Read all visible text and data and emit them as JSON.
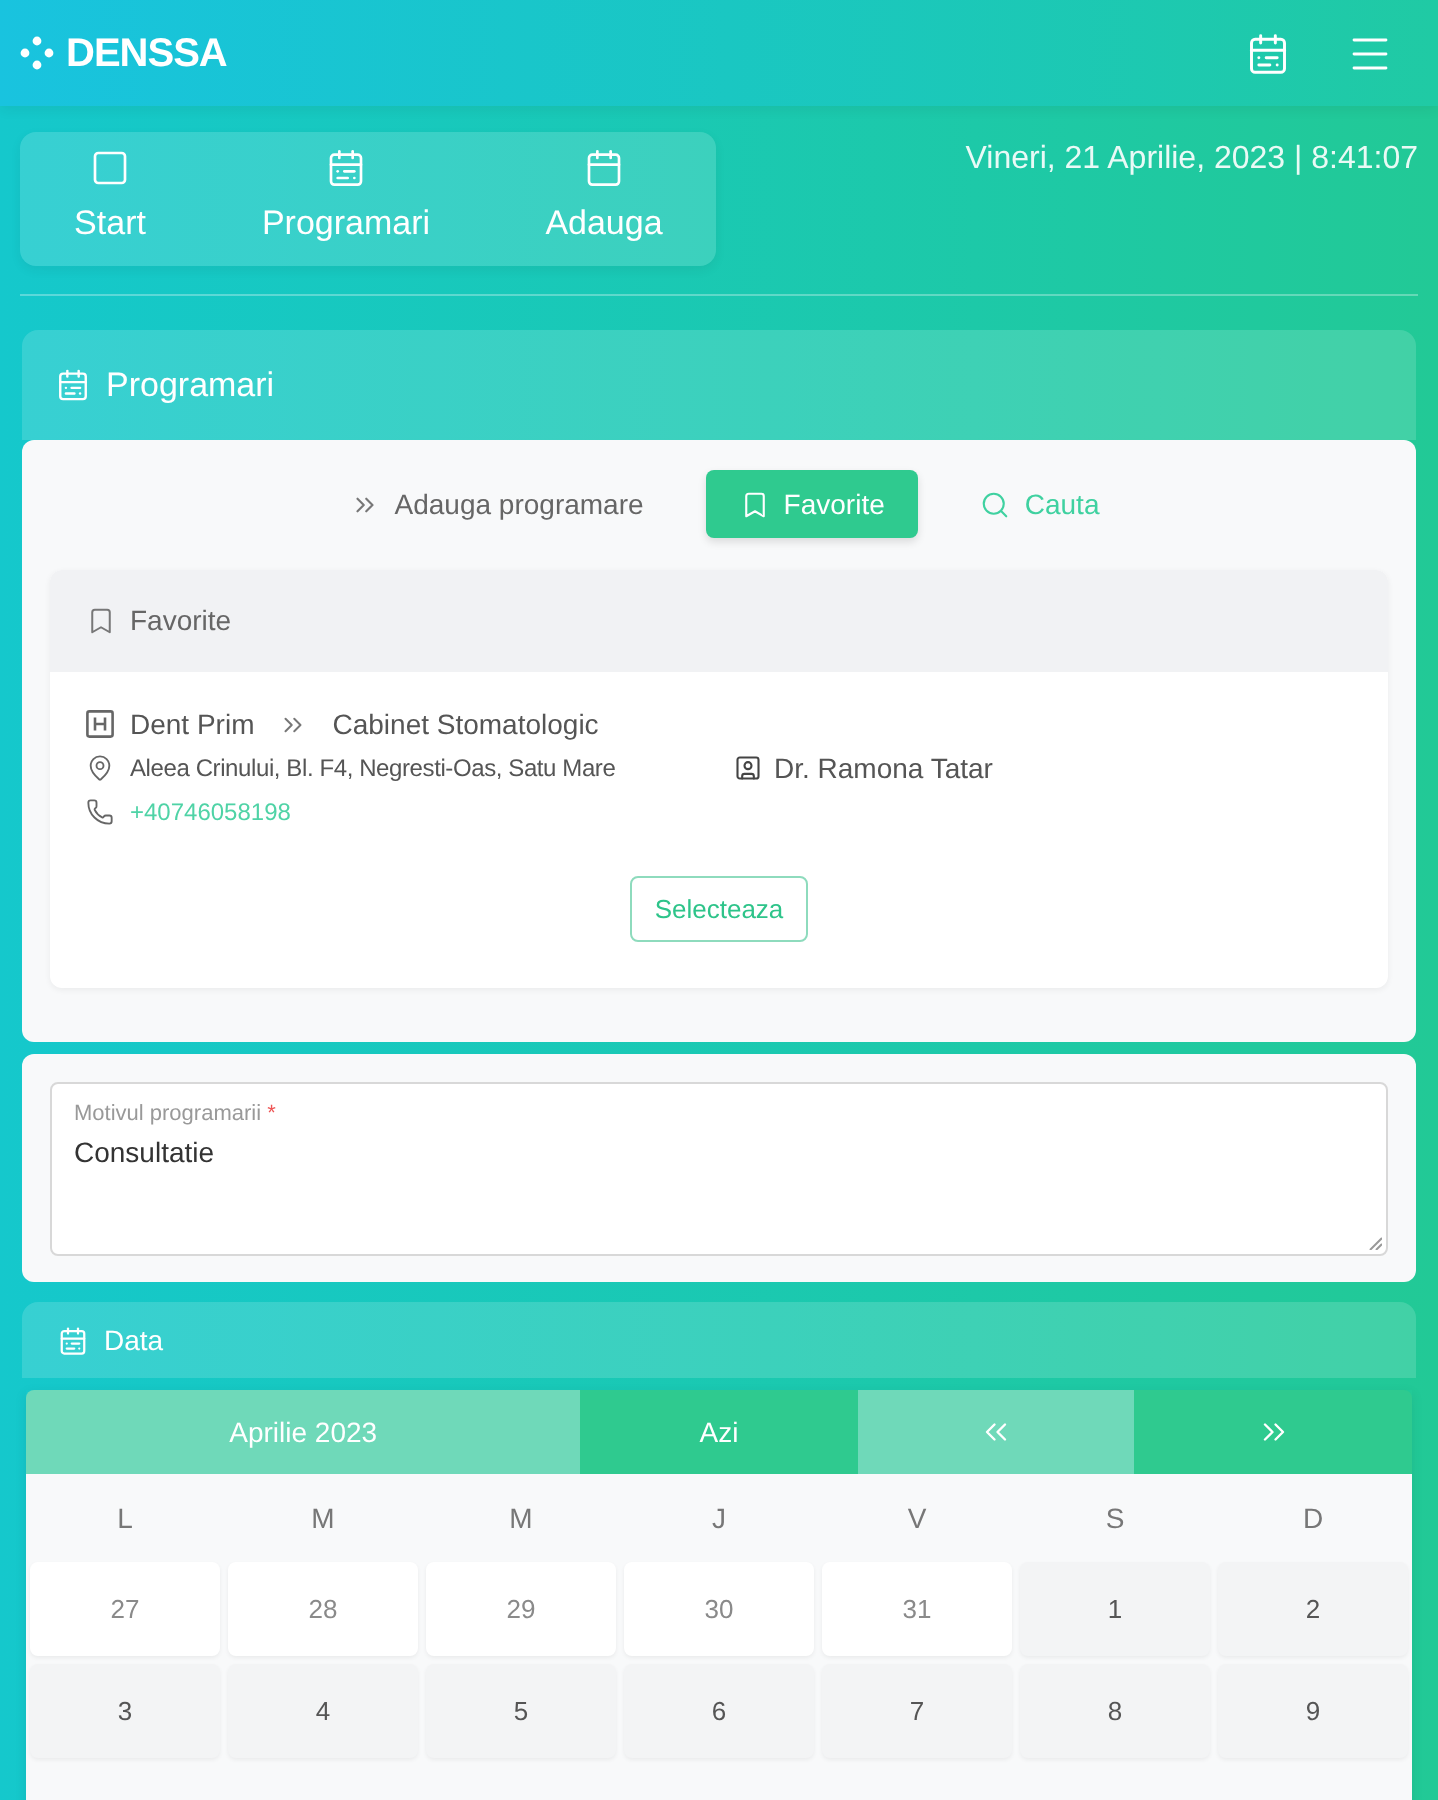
{
  "header": {
    "logo": "DENSSA"
  },
  "nav": [
    {
      "label": "Start",
      "kind": "start"
    },
    {
      "label": "Programari",
      "kind": "appointments"
    },
    {
      "label": "Adauga",
      "kind": "add"
    }
  ],
  "datetime": "Vineri, 21 Aprilie, 2023 | 8:41:07",
  "appointments": {
    "title": "Programari",
    "tabs": [
      {
        "label": "Adauga programare",
        "kind": "add",
        "selected": false
      },
      {
        "label": "Favorite",
        "kind": "favorites",
        "selected": true
      },
      {
        "label": "Cauta",
        "kind": "search",
        "selected": false
      }
    ],
    "favorites": {
      "title": "Favorite",
      "items": [
        {
          "clinic": "Dent Prim",
          "cabinet": "Cabinet Stomatologic",
          "address": "Aleea Crinului, Bl. F4, Negresti-Oas, Satu Mare",
          "doctor": "Dr. Ramona Tatar",
          "phone": "+40746058198",
          "button": "Selecteaza"
        }
      ]
    }
  },
  "reason_field": {
    "label": "Motivul programarii",
    "required_mark": "*",
    "value": "Consultatie"
  },
  "date_card": {
    "title": "Data",
    "calendar": {
      "month": "Aprilie 2023",
      "today_button": "Azi",
      "weekdays": [
        "L",
        "M",
        "M",
        "J",
        "V",
        "S",
        "D"
      ],
      "weeks": [
        [
          {
            "day": "27",
            "outside_month": true
          },
          {
            "day": "28",
            "outside_month": true
          },
          {
            "day": "29",
            "outside_month": true
          },
          {
            "day": "30",
            "outside_month": true
          },
          {
            "day": "31",
            "outside_month": true
          },
          {
            "day": "1",
            "outside_month": false
          },
          {
            "day": "2",
            "outside_month": false
          }
        ],
        [
          {
            "day": "3",
            "outside_month": false
          },
          {
            "day": "4",
            "outside_month": false
          },
          {
            "day": "5",
            "outside_month": false
          },
          {
            "day": "6",
            "outside_month": false
          },
          {
            "day": "7",
            "outside_month": false
          },
          {
            "day": "8",
            "outside_month": false
          },
          {
            "day": "9",
            "outside_month": false
          }
        ]
      ]
    }
  }
}
